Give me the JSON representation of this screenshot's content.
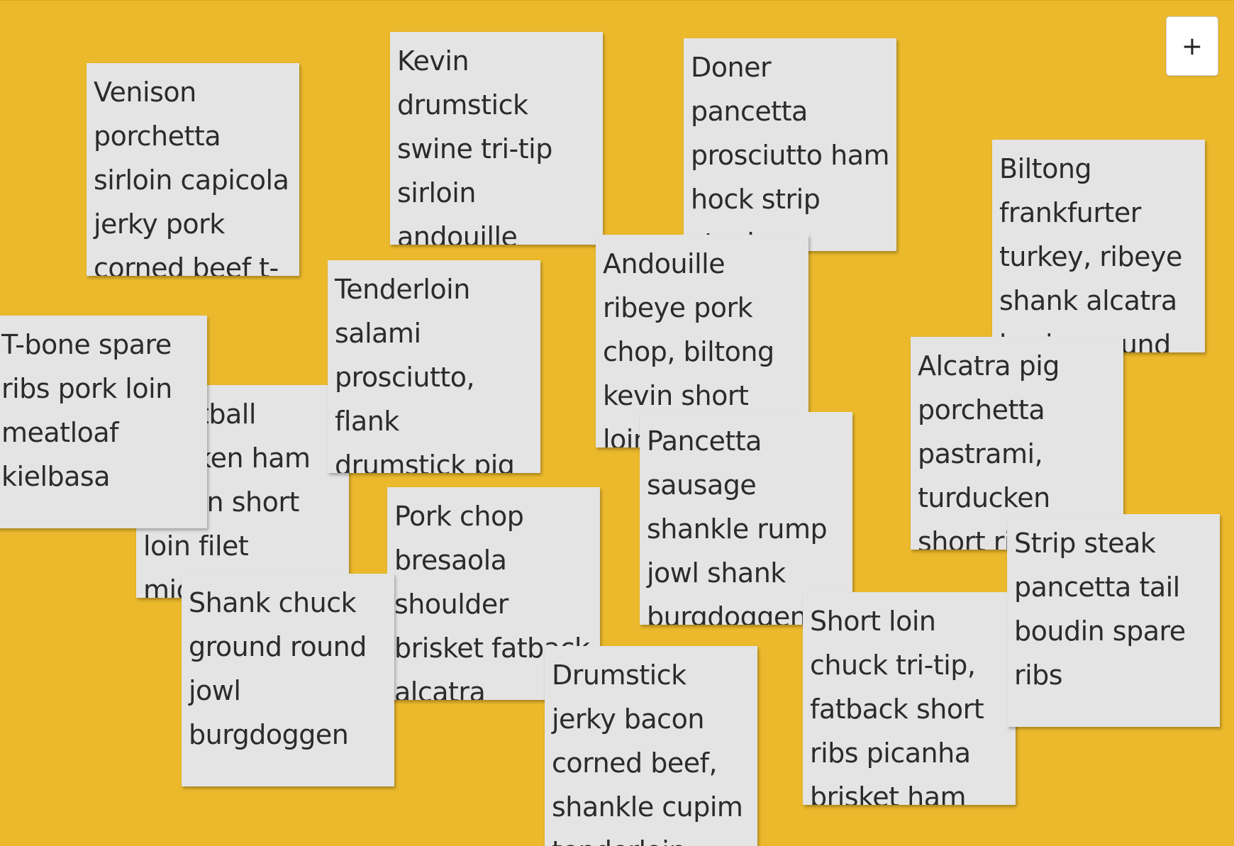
{
  "toolbar": {
    "add_label": "+"
  },
  "notes": [
    {
      "text": "Venison porchetta sirloin capicola jerky pork corned beef t-bone"
    },
    {
      "text": "Kevin drumstick swine tri-tip sirloin andouille"
    },
    {
      "text": "Doner pancetta prosciutto ham hock strip steak"
    },
    {
      "text": "Biltong frankfurter turkey, ribeye shank alcatra kevin ground"
    },
    {
      "text": "Meatball chicken ham bacon short loin filet mignon"
    },
    {
      "text": "T-bone spare ribs pork loin meatloaf kielbasa"
    },
    {
      "text": "Tenderloin salami prosciutto, flank drumstick pig"
    },
    {
      "text": "Andouille ribeye pork chop, biltong kevin short loin"
    },
    {
      "text": "Alcatra pig porchetta pastrami, turducken short ribs"
    },
    {
      "text": "Pork chop bresaola shoulder brisket fatback alcatra"
    },
    {
      "text": "Pancetta sausage shankle rump jowl shank burgdoggen"
    },
    {
      "text": "Short loin chuck tri-tip, fatback short ribs picanha brisket ham"
    },
    {
      "text": "Strip steak pancetta tail boudin spare ribs"
    },
    {
      "text": "Shank chuck ground round jowl burgdoggen"
    },
    {
      "text": "Drumstick jerky bacon corned beef, shankle cupim tenderloin"
    }
  ]
}
